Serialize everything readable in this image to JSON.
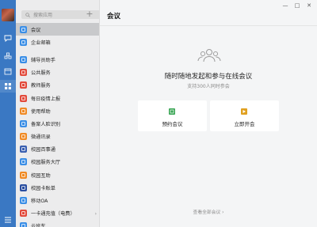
{
  "sidebar": {
    "search_placeholder": "搜索应用",
    "add_symbol": "+",
    "items": [
      {
        "label": "会议",
        "icon": "meeting-icon",
        "color": "#3a8ee6",
        "selected": true
      },
      {
        "label": "企业邮箱",
        "icon": "mail-icon",
        "color": "#3a8ee6"
      },
      {
        "label": "辅导员助手",
        "icon": "counselor-icon",
        "color": "#3a8ee6"
      },
      {
        "label": "公共服务",
        "icon": "public-service-icon",
        "color": "#e24a3b"
      },
      {
        "label": "教师服务",
        "icon": "teacher-service-icon",
        "color": "#e24a3b"
      },
      {
        "label": "每日疫情上报",
        "icon": "epidemic-report-icon",
        "color": "#e24a3b"
      },
      {
        "label": "使用帮助",
        "icon": "help-icon",
        "color": "#f08a24"
      },
      {
        "label": "备案人脸识别",
        "icon": "face-recognition-icon",
        "color": "#3a8ee6"
      },
      {
        "label": "微通讯录",
        "icon": "contacts-icon",
        "color": "#f08a24"
      },
      {
        "label": "校园百事通",
        "icon": "campus-info-icon",
        "color": "#3a5fb0"
      },
      {
        "label": "校园服务大厅",
        "icon": "service-hall-icon",
        "color": "#3a8ee6"
      },
      {
        "label": "校园互助",
        "icon": "mutual-aid-icon",
        "color": "#f08a24"
      },
      {
        "label": "校园卡账单",
        "icon": "campus-card-icon",
        "color": "#2a4ea0"
      },
      {
        "label": "移动OA",
        "icon": "mobile-oa-icon",
        "color": "#3a8ee6"
      },
      {
        "label": "一卡通充值（电费）",
        "icon": "card-recharge-icon",
        "color": "#e24a3b",
        "arrow": "›"
      },
      {
        "label": "云班车",
        "icon": "bus-icon",
        "color": "#3a8ee6"
      }
    ]
  },
  "main": {
    "title": "会议",
    "window_controls": [
      "—",
      "□",
      "✕"
    ],
    "hero_title": "随时随地发起和参与在线会议",
    "hero_subtitle": "支持300人同时参会",
    "cards": [
      {
        "label": "预约会议",
        "icon": "schedule-meeting-icon",
        "color": "#3aa655"
      },
      {
        "label": "立即开会",
        "icon": "start-meeting-icon",
        "color": "#e0a020"
      }
    ],
    "history_link": "查看全部会议 ›"
  }
}
